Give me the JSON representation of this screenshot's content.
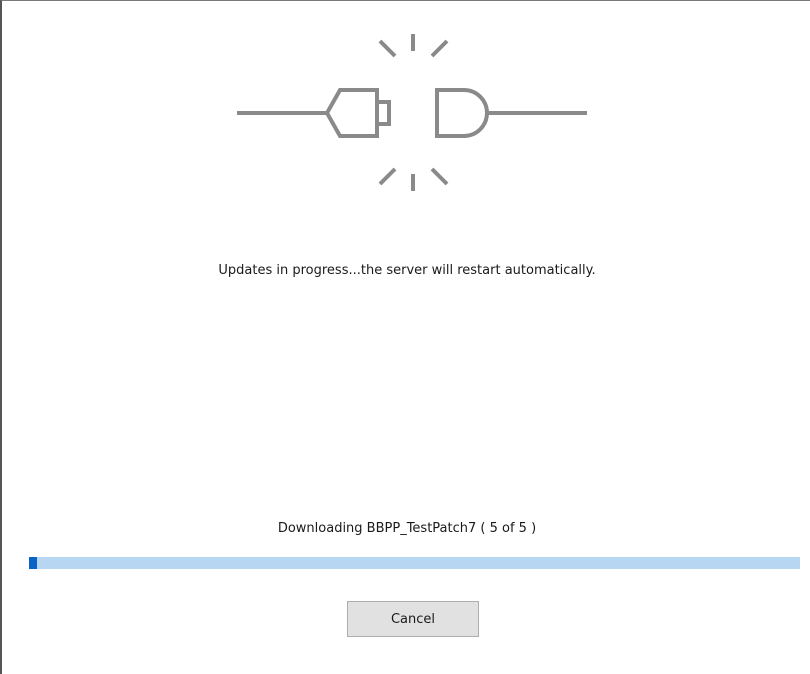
{
  "illustration": {
    "icon": "disconnected-plug-icon",
    "color": "#8a8a8a"
  },
  "status_message": "Updates in progress...the server will restart automatically.",
  "download": {
    "text": "Downloading BBPP_TestPatch7 ( 5 of 5 )",
    "progress_fraction": 0.01,
    "track_color": "#b7d6f2",
    "fill_color": "#0a64c8"
  },
  "cancel_label": "Cancel"
}
